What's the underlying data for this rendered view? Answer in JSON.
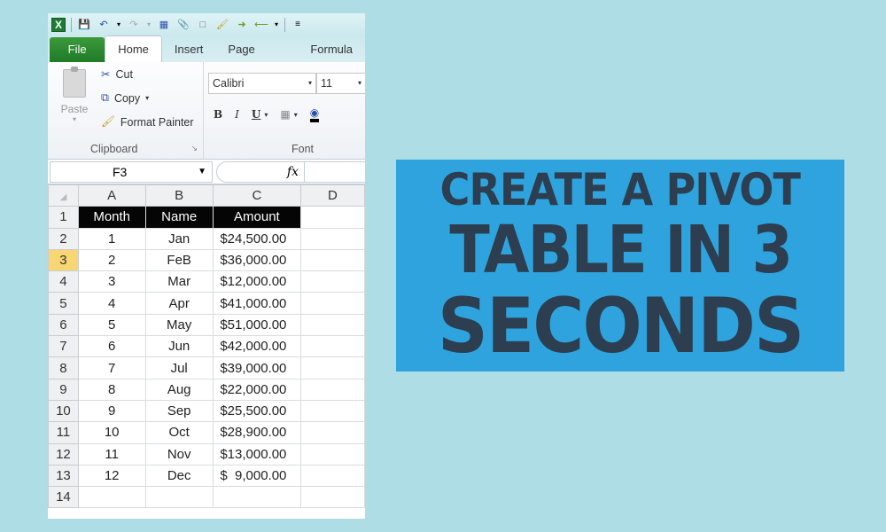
{
  "quick_access": {
    "icons": [
      "excel-logo",
      "save",
      "undo",
      "undo-dropdown",
      "redo",
      "redo-dropdown",
      "print-preview",
      "attach",
      "new-document",
      "format-painter",
      "forward",
      "back",
      "back-dropdown",
      "customize"
    ]
  },
  "ribbon": {
    "tabs": [
      {
        "label": "File"
      },
      {
        "label": "Home"
      },
      {
        "label": "Insert"
      },
      {
        "label": "Page Layout"
      },
      {
        "label": "Formula"
      }
    ],
    "clipboard": {
      "paste_label": "Paste",
      "cut_label": "Cut",
      "copy_label": "Copy",
      "format_painter_label": "Format Painter",
      "group_label": "Clipboard"
    },
    "font": {
      "font_name": "Calibri",
      "font_size": "11",
      "bold": "B",
      "italic": "I",
      "underline": "U",
      "group_label": "Font"
    }
  },
  "formula_bar": {
    "name_box": "F3",
    "fx_label": "fx",
    "value": ""
  },
  "sheet": {
    "columns": [
      "A",
      "B",
      "C",
      "D"
    ],
    "selected_row": "3",
    "header_row": {
      "row": "1",
      "cells": [
        "Month",
        "Name",
        "Amount"
      ]
    },
    "rows": [
      {
        "row": "2",
        "month": "1",
        "name": "Jan",
        "amount": "$24,500.00"
      },
      {
        "row": "3",
        "month": "2",
        "name": "FeB",
        "amount": "$36,000.00"
      },
      {
        "row": "4",
        "month": "3",
        "name": "Mar",
        "amount": "$12,000.00"
      },
      {
        "row": "5",
        "month": "4",
        "name": "Apr",
        "amount": "$41,000.00"
      },
      {
        "row": "6",
        "month": "5",
        "name": "May",
        "amount": "$51,000.00"
      },
      {
        "row": "7",
        "month": "6",
        "name": "Jun",
        "amount": "$42,000.00"
      },
      {
        "row": "8",
        "month": "7",
        "name": "Jul",
        "amount": "$39,000.00"
      },
      {
        "row": "9",
        "month": "8",
        "name": "Aug",
        "amount": "$22,000.00"
      },
      {
        "row": "10",
        "month": "9",
        "name": "Sep",
        "amount": "$25,500.00"
      },
      {
        "row": "11",
        "month": "10",
        "name": "Oct",
        "amount": "$28,900.00"
      },
      {
        "row": "12",
        "month": "11",
        "name": "Nov",
        "amount": "$13,000.00"
      },
      {
        "row": "13",
        "month": "12",
        "name": "Dec",
        "amount": "$  9,000.00"
      },
      {
        "row": "14",
        "month": "",
        "name": "",
        "amount": ""
      }
    ]
  },
  "headline": {
    "line1": "CREATE A PIVOT",
    "line2": "TABLE IN 3",
    "line3": "SECONDS",
    "background_color": "#2ea3dd",
    "text_color": "#2c3e50"
  },
  "colors": {
    "page_background": "#aedde6",
    "file_tab": "#2a8a2e",
    "selected_row_header": "#f9d674",
    "header_row_fill": "#050505"
  }
}
